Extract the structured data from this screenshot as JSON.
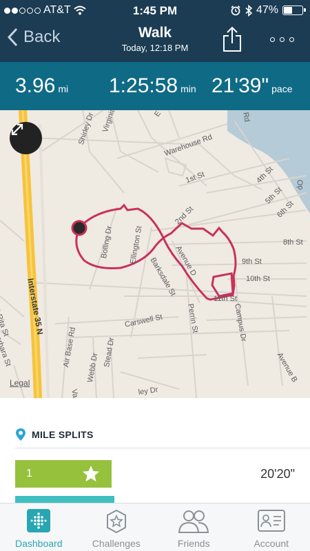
{
  "status_bar": {
    "carrier": "AT&T",
    "signal_dots": [
      true,
      true,
      false,
      false,
      false
    ],
    "time": "1:45 PM",
    "battery_percent": "47%",
    "battery_level": 0.47
  },
  "nav": {
    "back_label": "Back",
    "title": "Walk",
    "subtitle": "Today, 12:18 PM"
  },
  "stats": {
    "distance": {
      "value": "3.96",
      "unit": "mi"
    },
    "duration": {
      "value": "1:25:58",
      "unit": "min"
    },
    "pace": {
      "value": "21'39\"",
      "unit": "pace"
    }
  },
  "map": {
    "legal_label": "Legal",
    "streets": {
      "warehouse": "Warehouse Rd",
      "st1": "1st St",
      "st2": "2nd St",
      "st4": "4th St",
      "st5": "5th St",
      "st6": "6th St",
      "st8": "8th St",
      "st9": "9th St",
      "st10": "10th St",
      "st11": "11th St",
      "bolling": "Bolling Dr",
      "ellington": "Ellington St",
      "barksdale": "Barksdale St",
      "avenue_d": "Avenue D",
      "caswell": "Carswell St",
      "perrin": "Perrin St",
      "campus": "Campus Dr",
      "avenue_b": "Avenue B",
      "airbase": "Air Base Rd",
      "webb": "Webb Dr",
      "stead": "Stead Dr",
      "shirley": "Shirley Dr",
      "virginia": "Virginia Dr",
      "e_c": "E C",
      "rita": "S Rita St",
      "barbara": "Barbara St",
      "ley": "ley Dr",
      "va": "Va",
      "rd": "Rd",
      "op": "Op",
      "interstate": "Interstate 35 N"
    }
  },
  "splits": {
    "header": "MILE SPLITS",
    "rows": [
      {
        "mile": "1",
        "time": "20'20\"",
        "fastest": true
      }
    ]
  },
  "tabs": [
    {
      "label": "Dashboard",
      "icon": "dashboard-icon",
      "active": true
    },
    {
      "label": "Challenges",
      "icon": "challenges-badge-icon",
      "active": false
    },
    {
      "label": "Friends",
      "icon": "friends-icon",
      "active": false
    },
    {
      "label": "Account",
      "icon": "account-card-icon",
      "active": false
    }
  ],
  "colors": {
    "header_bg": "#1b3c53",
    "stats_bg": "#0f6a85",
    "route": "#c8325a",
    "split_green": "#96c13d",
    "split_teal": "#3fbfbf",
    "tab_active": "#28a6b2"
  }
}
